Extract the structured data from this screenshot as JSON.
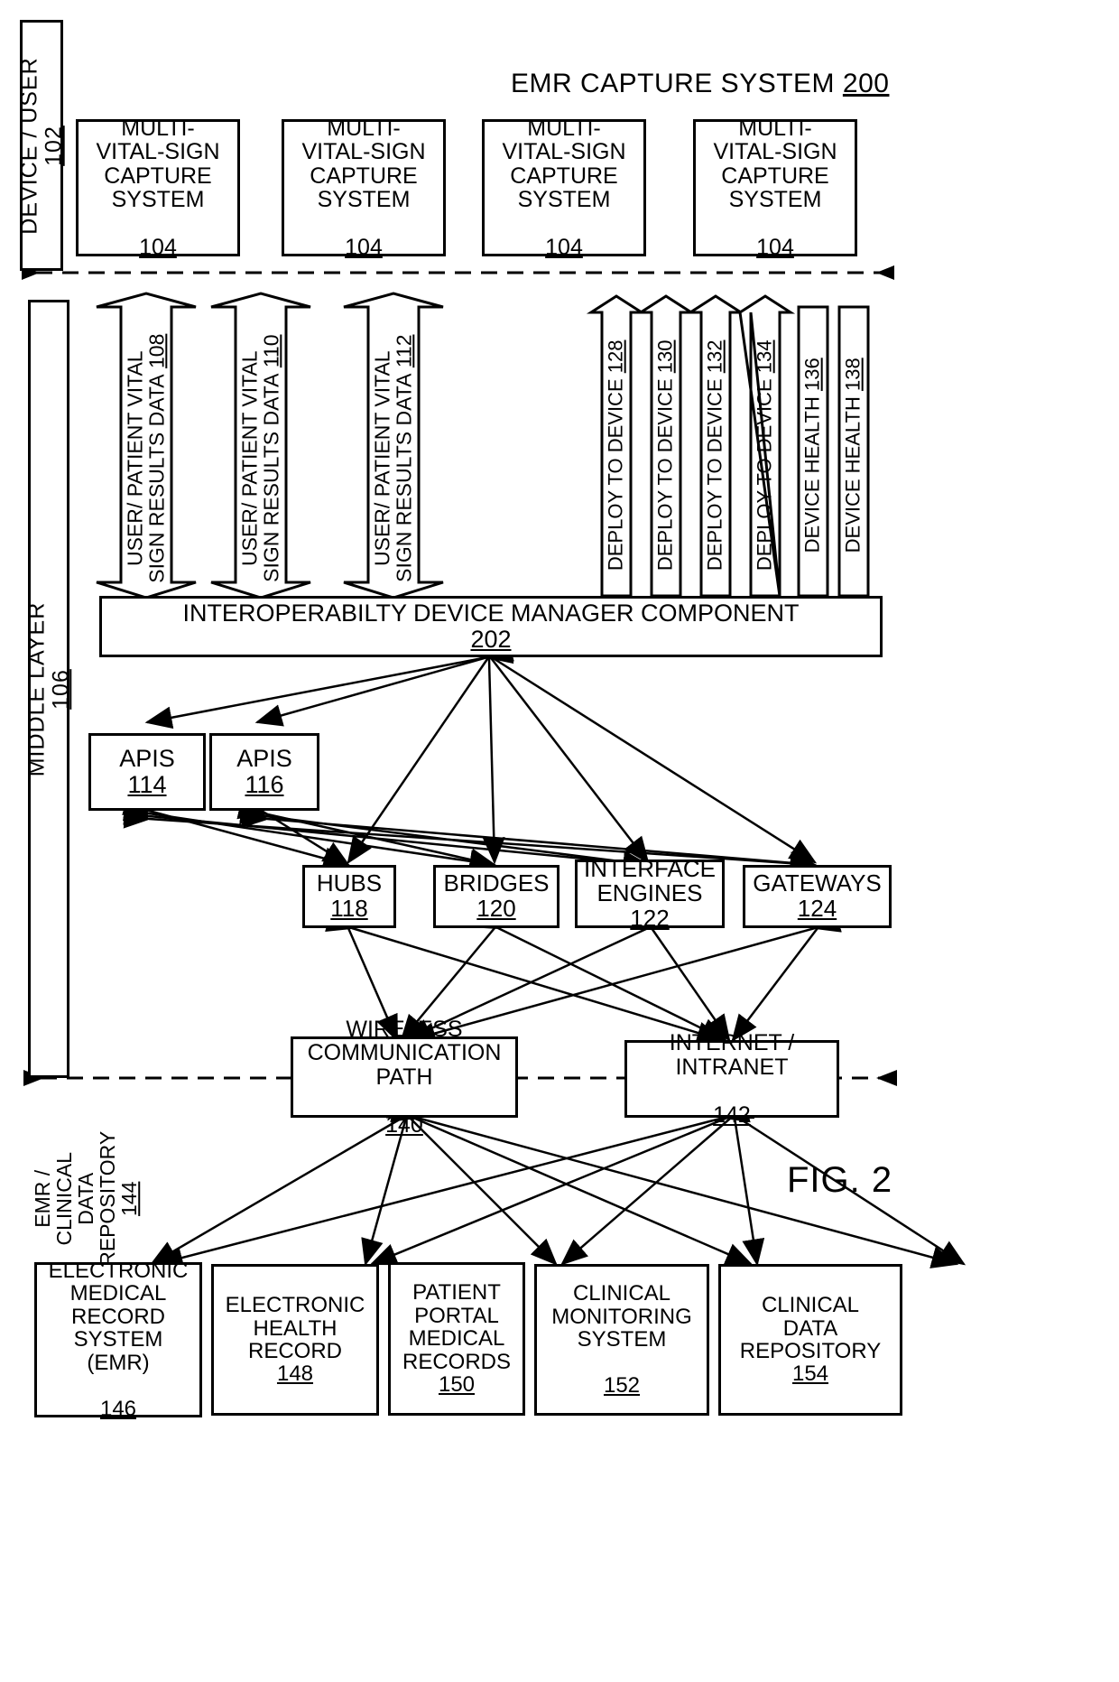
{
  "figure": {
    "label": "FIG. 2",
    "title": "EMR CAPTURE SYSTEM",
    "title_ref": "200"
  },
  "bands": {
    "device_user": {
      "label": "DEVICE / USER",
      "ref": "102"
    },
    "middle_layer": {
      "label": "MIDDLE LAYER",
      "ref": "106"
    },
    "repository": {
      "label": "EMR /\nCLINICAL\nDATA\nREPOSITORY",
      "line1": "EMR /",
      "line2": "CLINICAL",
      "line3": "DATA",
      "line4": "REPOSITORY",
      "ref": "144"
    }
  },
  "capture_systems": [
    {
      "line1": "MULTI-",
      "line2": "VITAL-SIGN",
      "line3": "CAPTURE",
      "line4": "SYSTEM",
      "ref": "104"
    },
    {
      "line1": "MULTI-",
      "line2": "VITAL-SIGN",
      "line3": "CAPTURE",
      "line4": "SYSTEM",
      "ref": "104"
    },
    {
      "line1": "MULTI-",
      "line2": "VITAL-SIGN",
      "line3": "CAPTURE",
      "line4": "SYSTEM",
      "ref": "104"
    },
    {
      "line1": "MULTI-",
      "line2": "VITAL-SIGN",
      "line3": "CAPTURE",
      "line4": "SYSTEM",
      "ref": "104"
    }
  ],
  "data_arrows": [
    {
      "line1": "USER/ PATIENT VITAL",
      "line2": "SIGN RESULTS DATA",
      "ref": "108"
    },
    {
      "line1": "USER/ PATIENT VITAL",
      "line2": "SIGN RESULTS DATA",
      "ref": "110"
    },
    {
      "line1": "USER/ PATIENT VITAL",
      "line2": "SIGN RESULTS DATA",
      "ref": "112"
    }
  ],
  "deploy_arrows": [
    {
      "label": "DEPLOY TO DEVICE",
      "ref": "128"
    },
    {
      "label": "DEPLOY TO DEVICE",
      "ref": "130"
    },
    {
      "label": "DEPLOY TO DEVICE",
      "ref": "132"
    },
    {
      "label": "DEPLOY TO DEVICE",
      "ref": "134"
    }
  ],
  "health_bars": [
    {
      "label": "DEVICE HEALTH",
      "ref": "136"
    },
    {
      "label": "DEVICE HEALTH",
      "ref": "138"
    }
  ],
  "manager": {
    "label": "INTEROPERABILTY DEVICE MANAGER COMPONENT",
    "ref": "202"
  },
  "apis": [
    {
      "label": "APIS",
      "ref": "114"
    },
    {
      "label": "APIS",
      "ref": "116"
    }
  ],
  "network_nodes": [
    {
      "line1": "HUBS",
      "line2": "",
      "ref": "118"
    },
    {
      "line1": "BRIDGES",
      "line2": "",
      "ref": "120"
    },
    {
      "line1": "INTERFACE",
      "line2": "ENGINES",
      "ref": "122"
    },
    {
      "line1": "GATEWAYS",
      "line2": "",
      "ref": "124"
    }
  ],
  "transport": [
    {
      "line1": "WIRELESS",
      "line2": "COMMUNICATION",
      "line3": "PATH",
      "ref": "140"
    },
    {
      "line1": "INTERNET /",
      "line2": "INTRANET",
      "line3": "",
      "ref": "142"
    }
  ],
  "repositories": [
    {
      "line1": "ELECTRONIC",
      "line2": "MEDICAL",
      "line3": "RECORD",
      "line4": "SYSTEM",
      "line5": "(EMR)",
      "ref": "146",
      "ref_inline": true
    },
    {
      "line1": "ELECTRONIC",
      "line2": "HEALTH",
      "line3": "RECORD",
      "line4": "",
      "line5": "",
      "ref": "148",
      "ref_inline": false
    },
    {
      "line1": "PATIENT",
      "line2": "PORTAL",
      "line3": "MEDICAL",
      "line4": "RECORDS",
      "line5": "",
      "ref": "150",
      "ref_inline": false
    },
    {
      "line1": "CLINICAL",
      "line2": "MONITORING",
      "line3": "SYSTEM",
      "line4": "",
      "line5": "",
      "ref": "152",
      "ref_inline": true
    },
    {
      "line1": "CLINICAL",
      "line2": "DATA",
      "line3": "REPOSITORY",
      "line4": "",
      "line5": "",
      "ref": "154",
      "ref_inline": false
    }
  ],
  "colors": {
    "ink": "#000000",
    "paper": "#ffffff"
  }
}
